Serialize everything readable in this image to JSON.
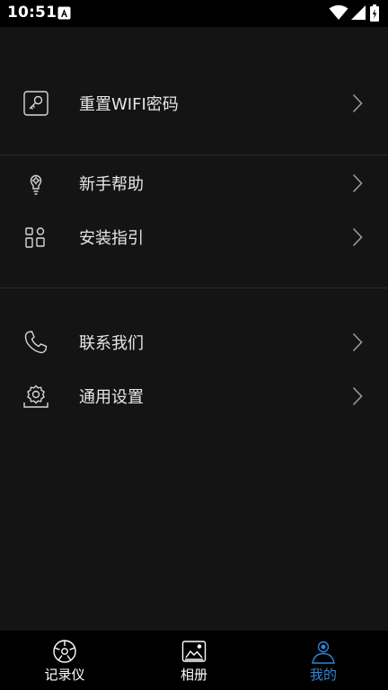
{
  "status_bar": {
    "time": "10:51",
    "icons": [
      "notification-a-icon",
      "wifi-icon",
      "cell-signal-icon",
      "battery-icon"
    ]
  },
  "menu": {
    "groups": [
      {
        "items": [
          {
            "label": "重置WIFI密码",
            "icon": "key-icon"
          }
        ]
      },
      {
        "items": [
          {
            "label": "新手帮助",
            "icon": "lightbulb-icon"
          },
          {
            "label": "安装指引",
            "icon": "install-guide-icon"
          }
        ]
      },
      {
        "items": [
          {
            "label": "联系我们",
            "icon": "phone-icon"
          },
          {
            "label": "通用设置",
            "icon": "gear-icon"
          }
        ]
      }
    ]
  },
  "tabbar": {
    "tabs": [
      {
        "label": "记录仪",
        "icon": "recorder-icon",
        "active": false
      },
      {
        "label": "相册",
        "icon": "album-icon",
        "active": false
      },
      {
        "label": "我的",
        "icon": "profile-icon",
        "active": true
      }
    ]
  },
  "colors": {
    "background": "#141414",
    "bar_background": "#000000",
    "divider": "#2a2a2a",
    "text": "#e6e6e6",
    "accent": "#2f86d6"
  }
}
